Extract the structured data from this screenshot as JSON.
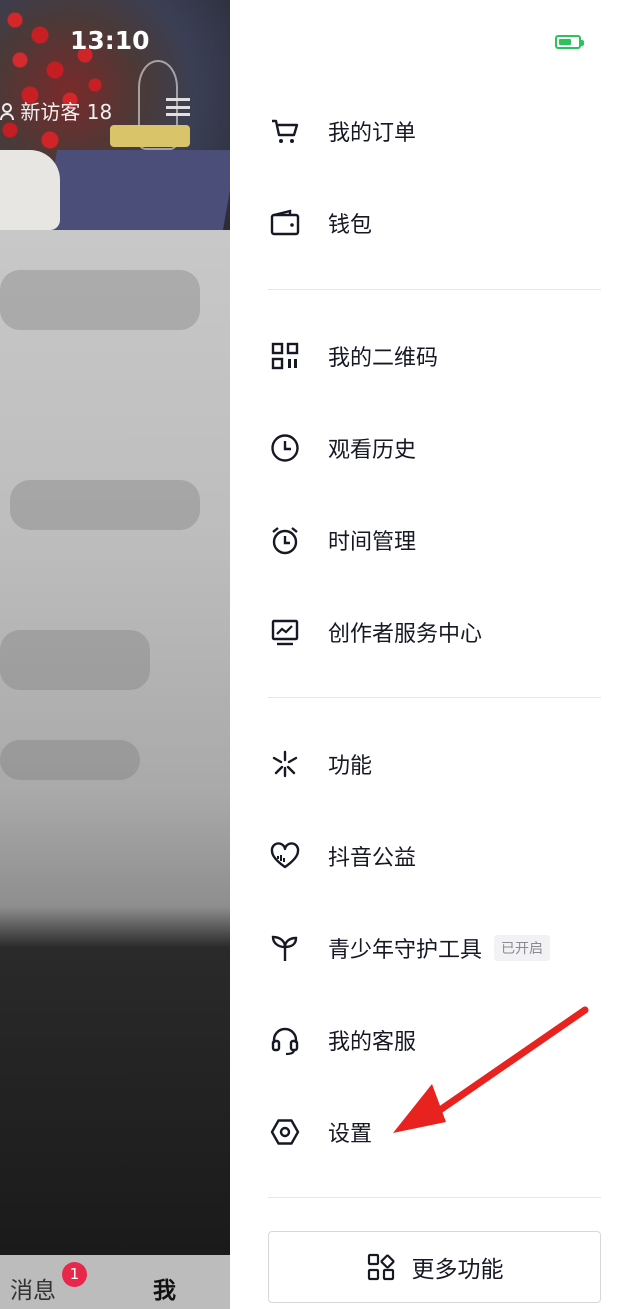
{
  "status_bar": {
    "time": "13:10"
  },
  "profile_header": {
    "visitor_label": "新访客 18"
  },
  "bottom_tabs": {
    "messages": "消息",
    "messages_badge": "1",
    "me": "我"
  },
  "drawer": {
    "items": [
      {
        "label": "我的订单",
        "icon": "cart-icon"
      },
      {
        "label": "钱包",
        "icon": "wallet-icon"
      },
      {
        "label": "我的二维码",
        "icon": "qrcode-icon"
      },
      {
        "label": "观看历史",
        "icon": "clock-icon"
      },
      {
        "label": "时间管理",
        "icon": "alarm-icon"
      },
      {
        "label": "创作者服务中心",
        "icon": "chart-monitor-icon"
      },
      {
        "label": "功能",
        "icon": "sparkle-icon"
      },
      {
        "label": "抖音公益",
        "icon": "heart-icon"
      },
      {
        "label": "青少年守护工具",
        "icon": "sprout-icon",
        "tag": "已开启"
      },
      {
        "label": "我的客服",
        "icon": "headset-icon"
      },
      {
        "label": "设置",
        "icon": "hexagon-settings-icon"
      }
    ],
    "more_button": "更多功能"
  },
  "colors": {
    "battery": "#2cc35c",
    "badge": "#e8274b",
    "annotation_arrow": "#e8221e",
    "text": "#161823"
  }
}
